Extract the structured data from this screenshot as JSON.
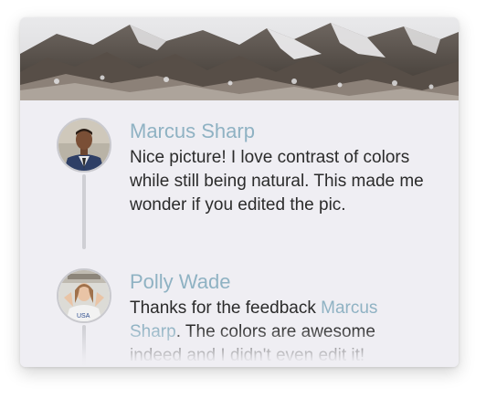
{
  "header_image": {
    "description_icon": "snowy-mountains-image"
  },
  "comments": [
    {
      "author": "Marcus Sharp",
      "body": "Nice picture! I love contrast of colors while still being natural. This made me wonder if you edited the pic.",
      "avatar_icon": "man-portrait-avatar"
    },
    {
      "author": "Polly Wade",
      "body_before": "Thanks for the feedback ",
      "mention": "Marcus Sharp",
      "body_after": ". The colors are awesome indeed and I didn't even edit it!",
      "avatar_icon": "woman-portrait-avatar"
    }
  ],
  "colors": {
    "accent": "#8fb2c3",
    "card_background": "#efeef3",
    "text": "#2b2b2b",
    "thread_line": "#cfcfd4"
  }
}
